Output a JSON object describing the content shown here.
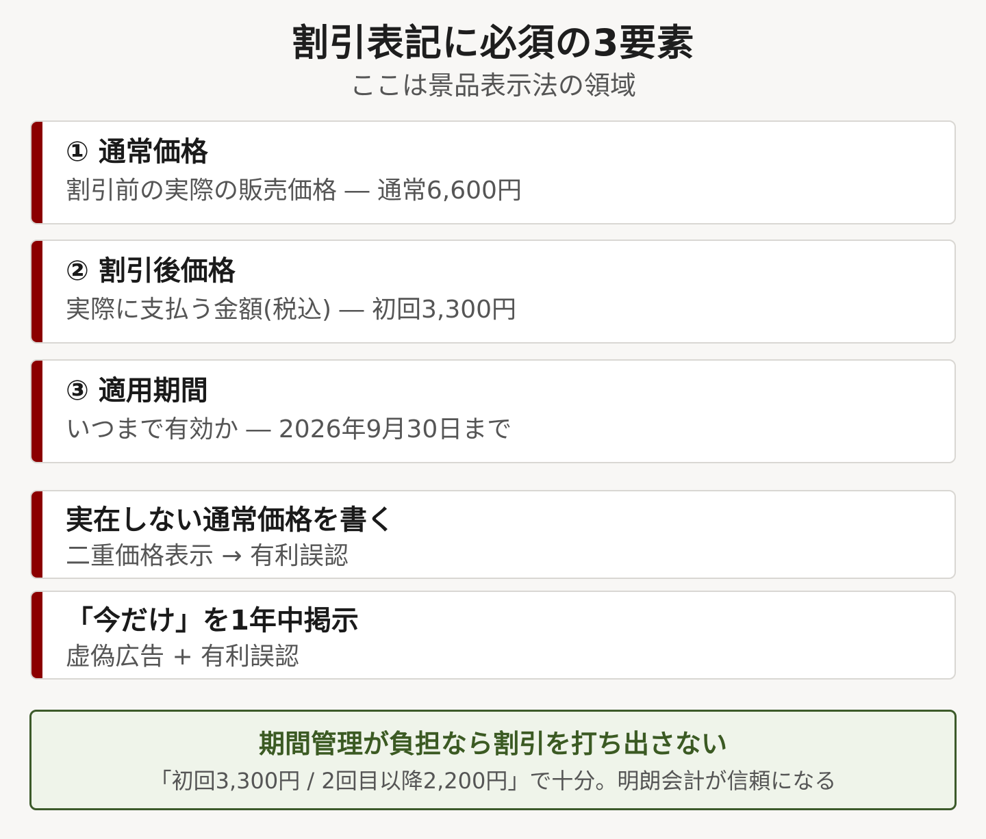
{
  "title": "割引表記に必須の3要素",
  "subtitle": "ここは景品表示法の領域",
  "required_elements": [
    {
      "heading": "① 通常価格",
      "description": "割引前の実際の販売価格 ― 通常6,600円"
    },
    {
      "heading": "② 割引後価格",
      "description": "実際に支払う金額(税込) ― 初回3,300円"
    },
    {
      "heading": "③ 適用期間",
      "description": "いつまで有効か ― 2026年9月30日まで"
    }
  ],
  "violations": [
    {
      "heading": "実在しない通常価格を書く",
      "description": "二重価格表示 → 有利誤認"
    },
    {
      "heading": "「今だけ」を1年中掲示",
      "description": "虚偽広告 + 有利誤認"
    }
  ],
  "conclusion": {
    "title": "期間管理が負担なら割引を打ち出さない",
    "text": "「初回3,300円 / 2回目以降2,200円」で十分。明朗会計が信頼になる"
  },
  "colors": {
    "accent_bar": "#8b0000",
    "conclusion_border": "#3c5a2a",
    "conclusion_title": "#3b5a23",
    "conclusion_background": "#eff4ea"
  }
}
